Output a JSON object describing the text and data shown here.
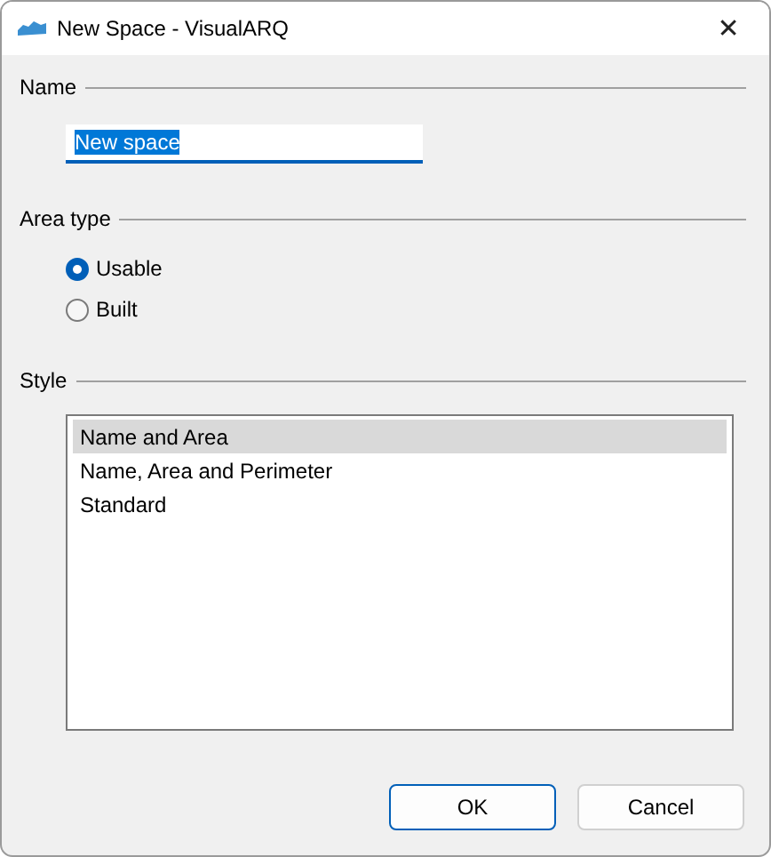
{
  "window": {
    "title": "New Space - VisualARQ",
    "close": "✕"
  },
  "name_section": {
    "label": "Name",
    "field": {
      "value": "New space",
      "text_selected": true
    }
  },
  "area_type_section": {
    "label": "Area type",
    "options": [
      {
        "label": "Usable",
        "selected": true
      },
      {
        "label": "Built",
        "selected": false
      }
    ]
  },
  "style_section": {
    "label": "Style",
    "items": [
      {
        "label": "Name and Area",
        "selected": true
      },
      {
        "label": "Name, Area and Perimeter",
        "selected": false
      },
      {
        "label": "Standard",
        "selected": false
      }
    ]
  },
  "buttons": [
    {
      "label": "OK",
      "default": true
    },
    {
      "label": "Cancel",
      "default": false
    }
  ]
}
